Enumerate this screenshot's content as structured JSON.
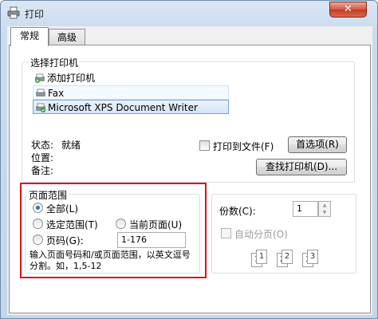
{
  "window": {
    "title": "打印",
    "close_symbol": "✕"
  },
  "tabs": [
    {
      "label": "常规"
    },
    {
      "label": "高级"
    }
  ],
  "select_printer": {
    "group_label": "选择打印机",
    "items": [
      {
        "label": "添加打印机",
        "icon": "add-printer-icon"
      },
      {
        "label": "Fax",
        "icon": "fax-printer-icon"
      },
      {
        "label": "Microsoft XPS Document Writer",
        "icon": "xps-printer-icon",
        "selected": true
      }
    ]
  },
  "status": {
    "status_label": "状态:",
    "status_value": "就绪",
    "location_label": "位置:",
    "comment_label": "备注:"
  },
  "print_to_file_label": "打印到文件(F)",
  "preferences_button": "首选项(R)",
  "find_printer_button": "查找打印机(D)...",
  "page_range": {
    "group_label": "页面范围",
    "all_label": "全部(L)",
    "selection_label": "选定范围(T)",
    "current_page_label": "当前页面(U)",
    "pages_label": "页码(G):",
    "pages_value": "1-176",
    "hint": "输入页面号码和/或页面范围，以英文逗号分割。如，1,5-12"
  },
  "copies": {
    "label": "份数(C):",
    "value": "1",
    "collate_label": "自动分页(O)",
    "collate_pages": [
      "1",
      "1",
      "2",
      "2",
      "3",
      "3"
    ]
  },
  "colors": {
    "highlight_box": "#e0101a",
    "selection": "#d3e6fb"
  }
}
